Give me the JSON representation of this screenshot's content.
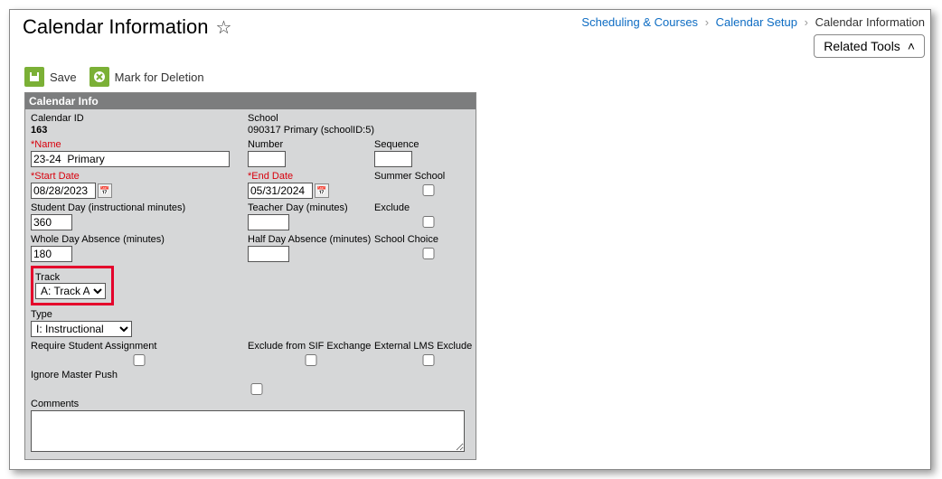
{
  "header": {
    "title": "Calendar Information",
    "breadcrumb": {
      "a": "Scheduling & Courses",
      "b": "Calendar Setup",
      "c": "Calendar Information"
    },
    "related_tools": "Related Tools"
  },
  "toolbar": {
    "save": "Save",
    "mark_del": "Mark for Deletion"
  },
  "panel": {
    "title": "Calendar Info"
  },
  "form": {
    "calendar_id_label": "Calendar ID",
    "calendar_id": "163",
    "school_label": "School",
    "school": "090317 Primary (schoolID:5)",
    "name_label": "Name",
    "name": "23-24  Primary",
    "number_label": "Number",
    "number": "",
    "sequence_label": "Sequence",
    "sequence": "",
    "start_date_label": "Start Date",
    "start_date": "08/28/2023",
    "end_date_label": "End Date",
    "end_date": "05/31/2024",
    "summer_label": "Summer School",
    "student_day_label": "Student Day (instructional minutes)",
    "student_day": "360",
    "teacher_day_label": "Teacher Day (minutes)",
    "teacher_day": "",
    "exclude_label": "Exclude",
    "whole_day_label": "Whole Day Absence (minutes)",
    "whole_day": "180",
    "half_day_label": "Half Day Absence (minutes)",
    "half_day": "",
    "school_choice_label": "School Choice",
    "track_label": "Track",
    "track_value": "A: Track A",
    "type_label": "Type",
    "type_value": "I: Instructional",
    "req_student_label": "Require Student Assignment",
    "exclude_sif_label": "Exclude from SIF Exchange",
    "ext_lms_label": "External LMS Exclude",
    "ignore_master_label": "Ignore Master Push",
    "comments_label": "Comments",
    "comments": ""
  }
}
